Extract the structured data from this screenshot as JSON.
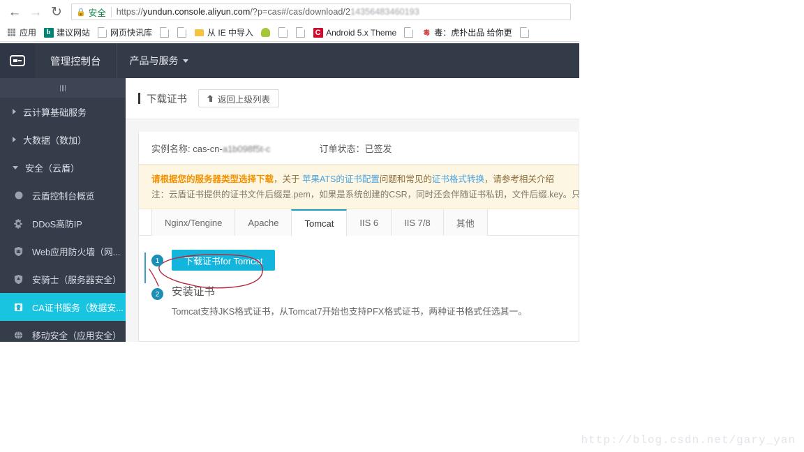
{
  "browser": {
    "nav": {
      "back_icon": "arrow-left-icon",
      "forward_icon": "arrow-right-icon",
      "reload_icon": "reload-icon"
    },
    "omnibox": {
      "lock_icon": "lock-icon",
      "secure_label": "安全",
      "url_scheme": "https://",
      "url_host": "yundun.console.aliyun.com",
      "url_path": "/?p=cas#/cas/download/2",
      "url_blurred": "14356483460193"
    },
    "bookmarks": [
      {
        "label": "应用",
        "icon": "apps-grid-icon"
      },
      {
        "label": "建议网站",
        "icon": "bing-icon"
      },
      {
        "label": "网页快讯库",
        "icon": "document-icon"
      },
      {
        "label": "",
        "icon": "document-icon"
      },
      {
        "label": "",
        "icon": "document-icon"
      },
      {
        "label": "从 IE 中导入",
        "icon": "folder-icon"
      },
      {
        "label": "",
        "icon": "android-icon"
      },
      {
        "label": "",
        "icon": "document-icon"
      },
      {
        "label": "",
        "icon": "document-icon"
      },
      {
        "label": "Android 5.x Theme",
        "icon": "c-red-icon"
      },
      {
        "label": "",
        "icon": "document-icon"
      },
      {
        "label": "毒：虎扑出品 给你更",
        "icon": "hupu-icon"
      },
      {
        "label": "",
        "icon": "document-icon"
      }
    ]
  },
  "topnav": {
    "logo_icon": "aliyun-logo-icon",
    "console_title": "管理控制台",
    "products_label": "产品与服务",
    "products_caret_icon": "chevron-down-icon"
  },
  "sidebar": {
    "collapse_icon": "collapse-handle-icon",
    "groups": [
      {
        "label": "云计算基础服务",
        "expanded": false,
        "caret_icon": "chevron-right-icon"
      },
      {
        "label": "大数据（数加）",
        "expanded": false,
        "caret_icon": "chevron-right-icon"
      },
      {
        "label": "安全（云盾）",
        "expanded": true,
        "caret_icon": "chevron-down-icon"
      }
    ],
    "items": [
      {
        "label": "云盾控制台概览",
        "icon": "circle-icon",
        "active": false
      },
      {
        "label": "DDoS高防IP",
        "icon": "gear-icon",
        "active": false
      },
      {
        "label": "Web应用防火墙（网...",
        "icon": "firewall-shield-icon",
        "active": false
      },
      {
        "label": "安骑士（服务器安全）",
        "icon": "shield-icon",
        "active": false
      },
      {
        "label": "CA证书服务（数据安...",
        "icon": "certificate-icon",
        "active": true
      },
      {
        "label": "移动安全（应用安全）",
        "icon": "mobile-security-icon",
        "active": false
      }
    ],
    "active_color": "#19c4e0"
  },
  "page": {
    "title": "下载证书",
    "back_button": "返回上级列表",
    "back_icon": "upload-arrow-icon",
    "instance_label": "实例名称: cas-cn-",
    "instance_blurred": "a1b098f5t-c",
    "order_status": "订单状态：已签发",
    "warning": {
      "strong": "请根据您的服务器类型选择下载",
      "mid1": "，关于 ",
      "link1": "苹果ATS的证书配置",
      "mid2": "问题和常见的",
      "link2": "证书格式转换",
      "mid3": "，请参考相关介绍",
      "note": "注：云盾证书提供的证书文件后缀是.pem，如果是系统创建的CSR，同时还会伴随证书私钥，文件后缀.key。只有是"
    },
    "tabs": [
      {
        "label": "Nginx/Tengine",
        "active": false
      },
      {
        "label": "Apache",
        "active": false
      },
      {
        "label": "Tomcat",
        "active": true
      },
      {
        "label": "IIS 6",
        "active": false
      },
      {
        "label": "IIS 7/8",
        "active": false
      },
      {
        "label": "其他",
        "active": false
      }
    ],
    "steps": [
      {
        "number": "1",
        "download_button": "下载证书for Tomcat"
      },
      {
        "number": "2",
        "title": "安装证书",
        "desc": "Tomcat支持JKS格式证书，从Tomcat7开始也支持PFX格式证书，两种证书格式任选其一。"
      }
    ],
    "download_button_color": "#14b5dd",
    "annotation_color": "#b5283c"
  },
  "watermark": "http://blog.csdn.net/gary_yan"
}
